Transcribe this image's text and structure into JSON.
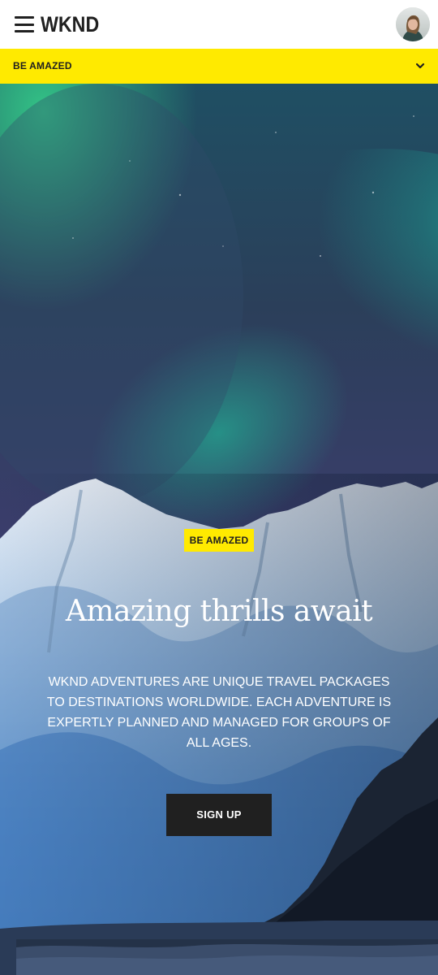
{
  "header": {
    "menu_icon": "hamburger-menu-icon",
    "logo_text": "WKND",
    "avatar_icon": "user-avatar"
  },
  "nav": {
    "current_label": "BE AMAZED",
    "chevron_icon": "chevron-down-icon"
  },
  "hero": {
    "tag": "BE AMAZED",
    "title": "Amazing thrills await",
    "description": "WKND ADVENTURES ARE UNIQUE TRAVEL PACKAGES TO DESTINATIONS WORLDWIDE. EACH ADVENTURE IS EXPERTLY PLANNED AND MANAGED FOR GROUPS OF ALL AGES.",
    "cta_label": "SIGN UP"
  },
  "colors": {
    "accent_yellow": "#ffea00",
    "text_dark": "#202020",
    "button_dark": "#202020",
    "white": "#ffffff"
  }
}
